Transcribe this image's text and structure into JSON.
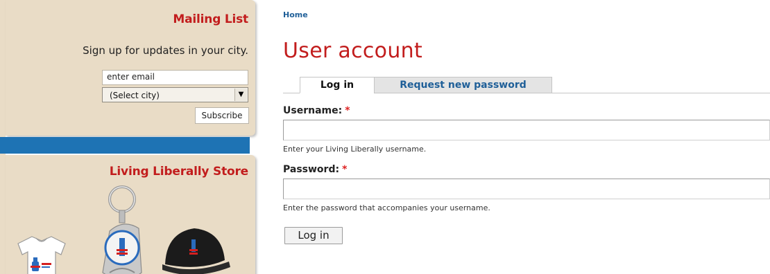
{
  "sidebar": {
    "mailing_list": {
      "title": "Mailing List",
      "signup_text": "Sign up for updates in your city.",
      "email_placeholder": "enter email",
      "city_selected": "(Select city)",
      "subscribe_label": "Subscribe"
    },
    "store": {
      "title": "Living Liberally Store"
    }
  },
  "main": {
    "breadcrumb": "Home",
    "title": "User account",
    "tabs": [
      {
        "label": "Log in",
        "active": true
      },
      {
        "label": "Request new password",
        "active": false
      }
    ],
    "username": {
      "label": "Username:",
      "required_mark": "*",
      "description": "Enter your Living Liberally username."
    },
    "password": {
      "label": "Password:",
      "required_mark": "*",
      "description": "Enter the password that accompanies your username."
    },
    "submit_label": "Log in"
  },
  "colors": {
    "accent_red": "#c21d1d",
    "link_blue": "#1f5f98",
    "panel_beige": "#e9dcc6",
    "band_blue": "#1e73b4"
  }
}
